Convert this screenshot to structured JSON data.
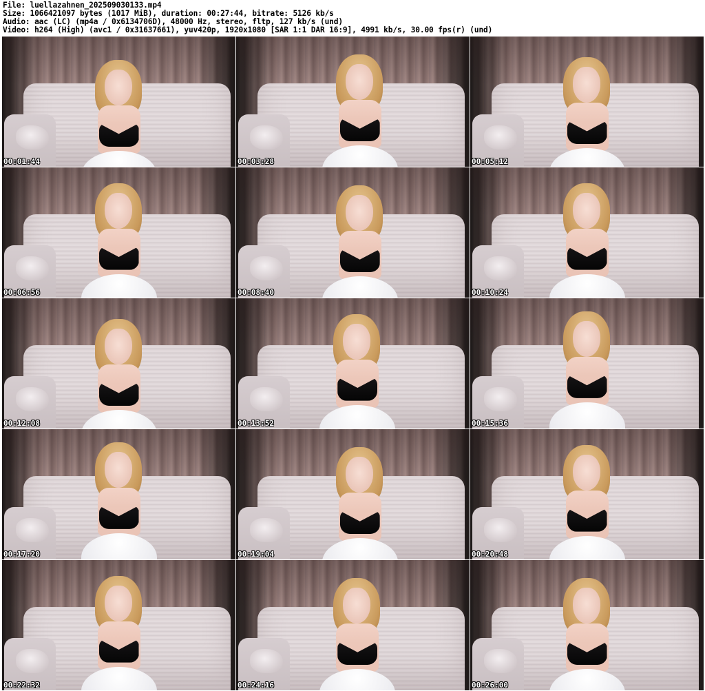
{
  "header": {
    "file": "File: luellazahnen_20250903013​3.mp4",
    "size": "Size: 1066421097 bytes (1017 MiB), duration: 00:27:44, bitrate: 5126 kb/s",
    "audio": "Audio: aac (LC) (mp4a / 0x6134706D), 48000 Hz, stereo, fltp, 127 kb/s (und)",
    "video": "Video: h264 (High) (avc1 / 0x31637661), yuv420p, 1920x1080 [SAR 1:1 DAR 16:9], 4991 kb/s, 30.00 fps(r) (und)"
  },
  "thumbnails": [
    {
      "timestamp": "00:01:44"
    },
    {
      "timestamp": "00:03:28"
    },
    {
      "timestamp": "00:05:12"
    },
    {
      "timestamp": "00:06:56"
    },
    {
      "timestamp": "00:08:40"
    },
    {
      "timestamp": "00:10:24"
    },
    {
      "timestamp": "00:12:08"
    },
    {
      "timestamp": "00:13:52"
    },
    {
      "timestamp": "00:15:36"
    },
    {
      "timestamp": "00:17:20"
    },
    {
      "timestamp": "00:19:04"
    },
    {
      "timestamp": "00:20:48"
    },
    {
      "timestamp": "00:22:32"
    },
    {
      "timestamp": "00:24:16"
    },
    {
      "timestamp": "00:26:00"
    }
  ]
}
